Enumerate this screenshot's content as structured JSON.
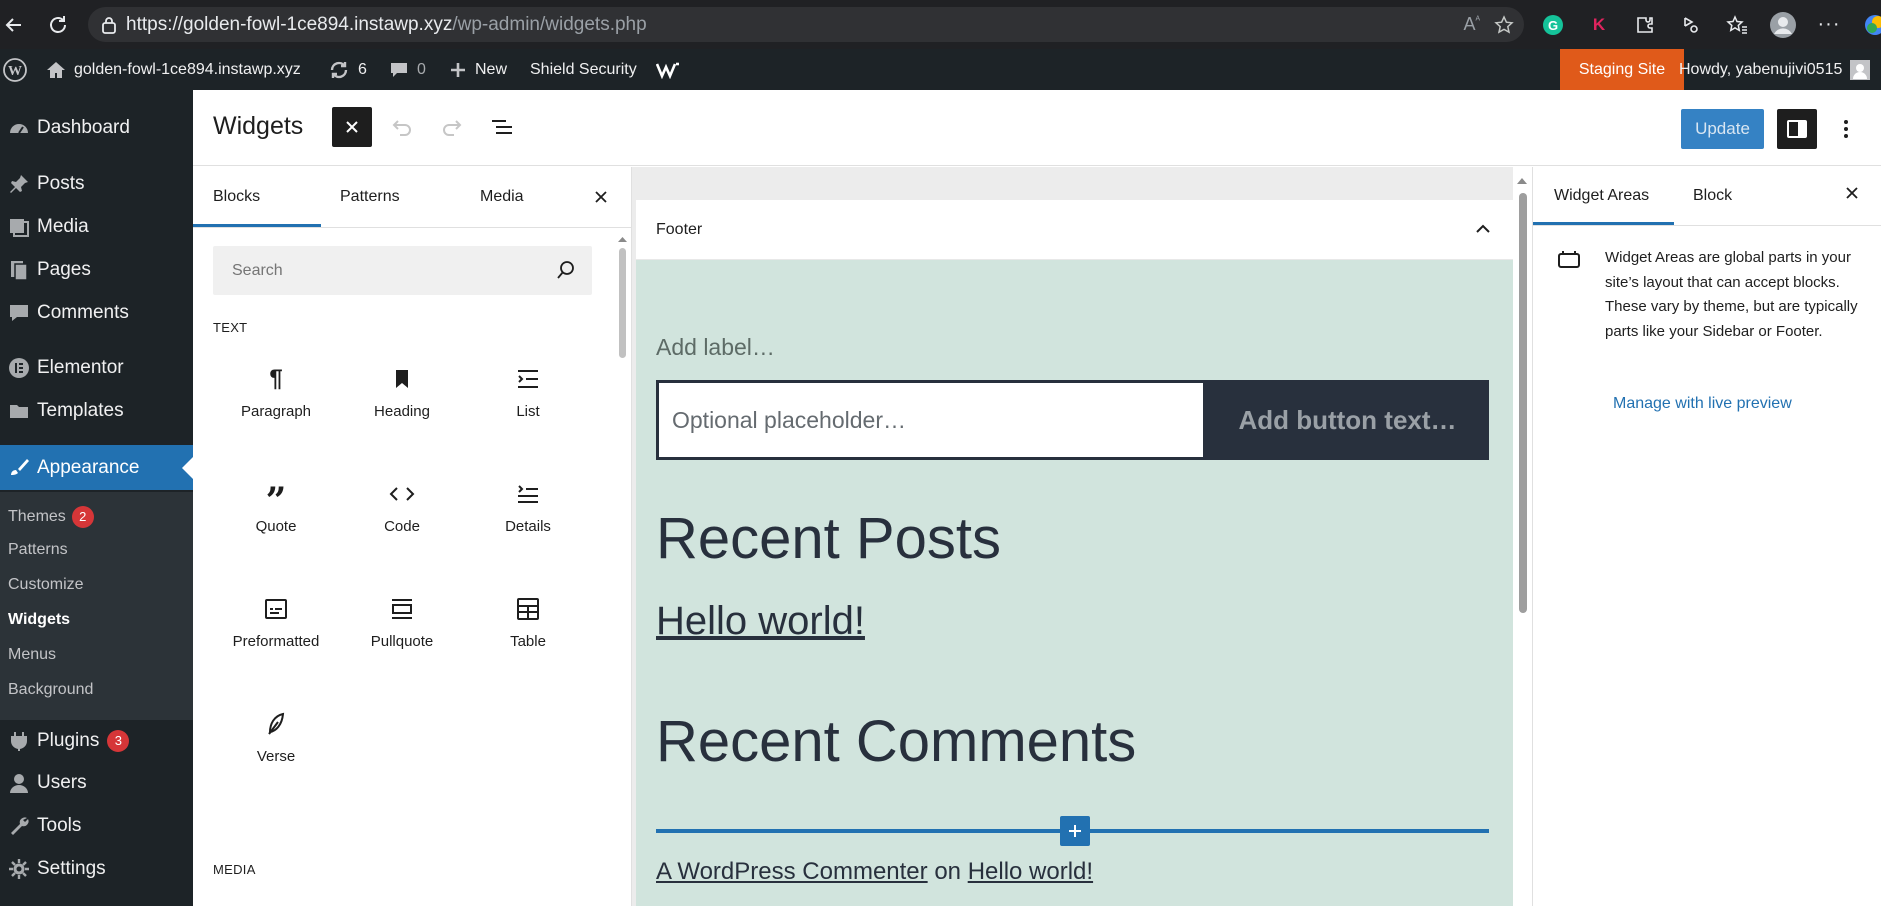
{
  "browser": {
    "url_host": "https://golden-fowl-1ce894.instawp.xyz",
    "url_path": "/wp-admin/widgets.php"
  },
  "adminbar": {
    "site_name": "golden-fowl-1ce894.instawp.xyz",
    "updates_count": "6",
    "comments_count": "0",
    "new_label": "New",
    "shield_label": "Shield Security",
    "staging_label": "Staging Site",
    "howdy_label": "Howdy, yabenujivi0515"
  },
  "sidebar": {
    "dashboard": "Dashboard",
    "posts": "Posts",
    "media": "Media",
    "pages": "Pages",
    "comments": "Comments",
    "elementor": "Elementor",
    "templates": "Templates",
    "appearance": "Appearance",
    "plugins": "Plugins",
    "plugins_badge": "3",
    "users": "Users",
    "tools": "Tools",
    "settings": "Settings",
    "submenu": {
      "themes": "Themes",
      "themes_badge": "2",
      "patterns": "Patterns",
      "customize": "Customize",
      "widgets": "Widgets",
      "menus": "Menus",
      "background": "Background"
    }
  },
  "editor": {
    "title": "Widgets",
    "update_label": "Update"
  },
  "inserter": {
    "tabs": [
      "Blocks",
      "Patterns",
      "Media"
    ],
    "search_placeholder": "Search",
    "category_text": "TEXT",
    "category_media": "MEDIA",
    "blocks": [
      "Paragraph",
      "Heading",
      "List",
      "Quote",
      "Code",
      "Details",
      "Preformatted",
      "Pullquote",
      "Table",
      "Verse"
    ]
  },
  "canvas": {
    "area_title": "Footer",
    "add_label": "Add label…",
    "search_placeholder": "Optional placeholder…",
    "search_button": "Add button text…",
    "recent_posts_heading": "Recent Posts",
    "post_link": "Hello world!",
    "recent_comments_heading": "Recent Comments",
    "comment_author": "A WordPress Commenter",
    "comment_on": "on",
    "comment_post": "Hello world!"
  },
  "settings": {
    "tabs": [
      "Widget Areas",
      "Block"
    ],
    "description": "Widget Areas are global parts in your site’s layout that can accept blocks. These vary by theme, but are typically parts like your Sidebar or Footer.",
    "live_preview_link": "Manage with live preview"
  },
  "colors": {
    "admin_dark": "#1d2327",
    "accent_blue": "#2271b1",
    "staging_orange": "#e05a1a",
    "footer_bg": "#d1e4dd"
  }
}
